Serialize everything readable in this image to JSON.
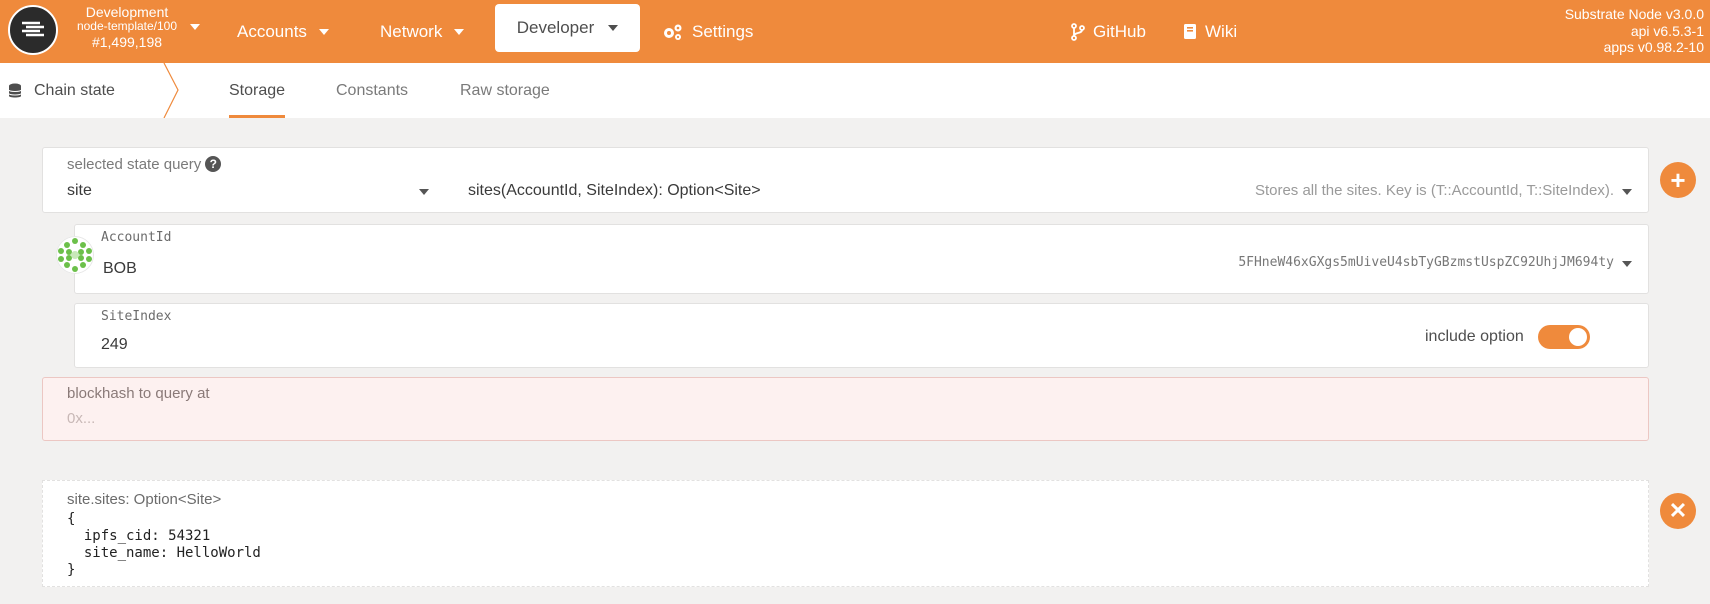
{
  "header": {
    "chain_name": "Development",
    "runtime": "node-template/100",
    "block": "#1,499,198",
    "nav": {
      "accounts": "Accounts",
      "network": "Network",
      "developer": "Developer",
      "settings": "Settings",
      "github": "GitHub",
      "wiki": "Wiki"
    },
    "node_info": {
      "node": "Substrate Node v3.0.0",
      "api": "api v6.5.3-1",
      "apps": "apps v0.98.2-10"
    }
  },
  "subnav": {
    "section": "Chain state",
    "tabs": [
      "Storage",
      "Constants",
      "Raw storage"
    ],
    "active_tab": "Storage"
  },
  "query": {
    "label": "selected state query",
    "module": "site",
    "method": "sites(AccountId, SiteIndex): Option<Site>",
    "description": "Stores all the sites. Key is (T::AccountId, T::SiteIndex)."
  },
  "account": {
    "label": "AccountId",
    "name": "BOB",
    "address": "5FHneW46xGXgs5mUiveU4sbTyGBzmstUspZC92UhjJM694ty"
  },
  "site_index": {
    "label": "SiteIndex",
    "value": "249",
    "include_option_label": "include option",
    "include_option": true
  },
  "blockhash": {
    "label": "blockhash to query at",
    "placeholder": "0x..."
  },
  "result": {
    "title": "site.sites: Option<Site>",
    "body": "{\n  ipfs_cid: 54321\n  site_name: HelloWorld\n}"
  },
  "colors": {
    "accent": "#ef8a3c",
    "error_bg": "#fdf1f0"
  },
  "icons": {
    "add": "plus-icon",
    "remove": "close-icon"
  }
}
